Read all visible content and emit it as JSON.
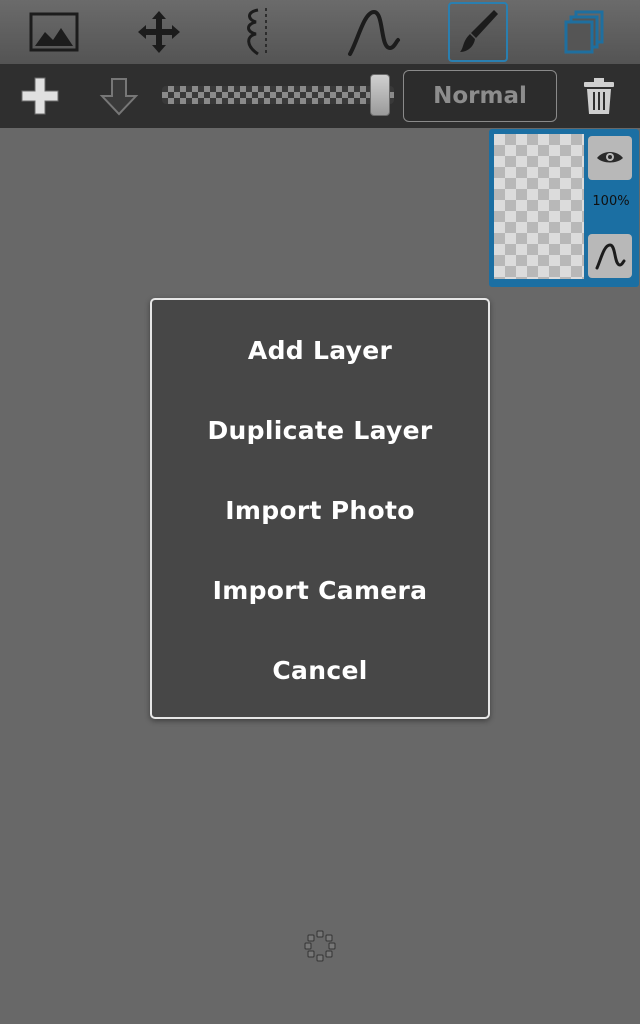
{
  "toolbar": {
    "tools": [
      {
        "icon": "image-icon",
        "selected": false
      },
      {
        "icon": "move-icon",
        "selected": false
      },
      {
        "icon": "symmetry-icon",
        "selected": false
      },
      {
        "icon": "curve-icon",
        "selected": false
      },
      {
        "icon": "brush-icon",
        "selected": true
      },
      {
        "icon": "layers-icon",
        "selected": false
      }
    ]
  },
  "layerbar": {
    "add_icon": "plus-icon",
    "merge_icon": "arrow-down-icon",
    "opacity_fraction": 0.98,
    "blend_mode": "Normal",
    "delete_icon": "trash-icon"
  },
  "layer_panel": {
    "opacity_label": "100%",
    "visibility_icon": "eye-icon",
    "brush_icon": "curve-icon"
  },
  "dialog": {
    "items": [
      "Add Layer",
      "Duplicate Layer",
      "Import Photo",
      "Import Camera",
      "Cancel"
    ]
  },
  "colors": {
    "background": "#686868",
    "accent": "#1b6fa3",
    "dialog": "#474747"
  }
}
